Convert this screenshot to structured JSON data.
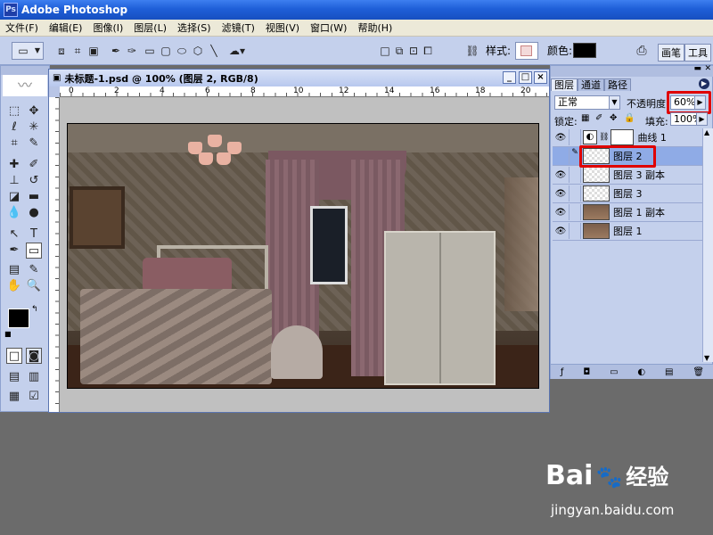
{
  "app": {
    "title": "Adobe Photoshop",
    "logo": "Ps"
  },
  "menu": [
    "文件(F)",
    "编辑(E)",
    "图像(I)",
    "图层(L)",
    "选择(S)",
    "滤镜(T)",
    "视图(V)",
    "窗口(W)",
    "帮助(H)"
  ],
  "options": {
    "style_label": "样式:",
    "color_label": "颜色:",
    "color_value": "#000000",
    "dock_tabs": [
      "画笔",
      "工具"
    ]
  },
  "document": {
    "title": "未标题-1.psd @ 100% (图层 2, RGB/8)",
    "ruler_ticks": [
      "0",
      "2",
      "4",
      "6",
      "8",
      "10",
      "12",
      "14",
      "16",
      "18",
      "20"
    ],
    "window_buttons": [
      "_",
      "□",
      "×"
    ]
  },
  "layers_panel": {
    "tabs": [
      "图层",
      "通道",
      "路径"
    ],
    "blend_mode": "正常",
    "opacity_label": "不透明度",
    "opacity_value": "60%",
    "lock_label": "锁定:",
    "fill_label": "填充:",
    "fill_value": "100%",
    "layers": [
      {
        "name": "曲线 1",
        "type": "adjustment",
        "visible": true,
        "active": false
      },
      {
        "name": "图层 2",
        "type": "transparent",
        "visible": false,
        "active": true
      },
      {
        "name": "图层 3 副本",
        "type": "transparent",
        "visible": true,
        "active": false
      },
      {
        "name": "图层 3",
        "type": "transparent",
        "visible": true,
        "active": false
      },
      {
        "name": "图层 1 副本",
        "type": "image",
        "visible": true,
        "active": false
      },
      {
        "name": "图层 1",
        "type": "image",
        "visible": true,
        "active": false
      }
    ],
    "bottom_icons": [
      "link-icon",
      "style-icon",
      "mask-icon",
      "set-icon",
      "adjustment-icon",
      "new-layer-icon",
      "trash-icon"
    ]
  },
  "watermark": {
    "brand": "Bai",
    "brand2": "经验",
    "site": "jingyan.baidu.com"
  },
  "colors": {
    "accent_red": "#e00000",
    "panel_bg": "#c4d0ec",
    "titlebar": "#1f5fd8"
  }
}
